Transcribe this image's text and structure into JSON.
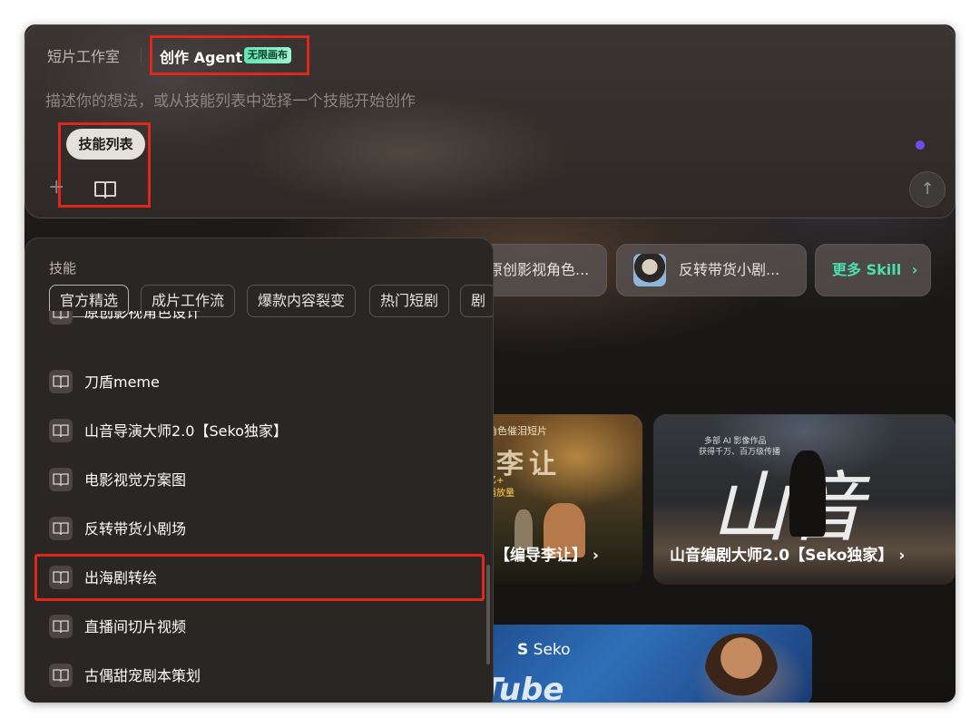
{
  "composer": {
    "tab_studio": "短片工作室",
    "tab_agent": "创作 Agent",
    "badge": "无限画布",
    "placeholder": "描述你的想法，或从技能列表中选择一个技能开始创作",
    "skill_chip": "技能列表",
    "send_icon": "arrow-up-icon",
    "accent_color": "#6b4ef0"
  },
  "pills": {
    "pill1": "原创影视角色...",
    "pill2": "反转带货小剧...",
    "more": "更多 Skill"
  },
  "cards": {
    "a_top": "角色催泪短片",
    "a_title": "李让",
    "a_sub1": "亿+",
    "a_sub2": "播放量",
    "a_label": "【编导李让】",
    "b_tag1": "多部 AI 影像作品",
    "b_tag2": "获得千万、百万级传播",
    "b_big": "山音",
    "b_label": "山音编剧大师2.0【Seko独家】",
    "c_logo": "Seko",
    "c_text": "Tube"
  },
  "panel": {
    "title": "技能",
    "categories": [
      "官方精选",
      "成片工作流",
      "爆款内容裂变",
      "热门短剧",
      "剧"
    ],
    "items": [
      "原创影视角色设计",
      "刀盾meme",
      "山音导演大师2.0【Seko独家】",
      "电影视觉方案图",
      "反转带货小剧场",
      "出海剧转绘",
      "直播间切片视频",
      "古偶甜宠剧本策划"
    ]
  }
}
